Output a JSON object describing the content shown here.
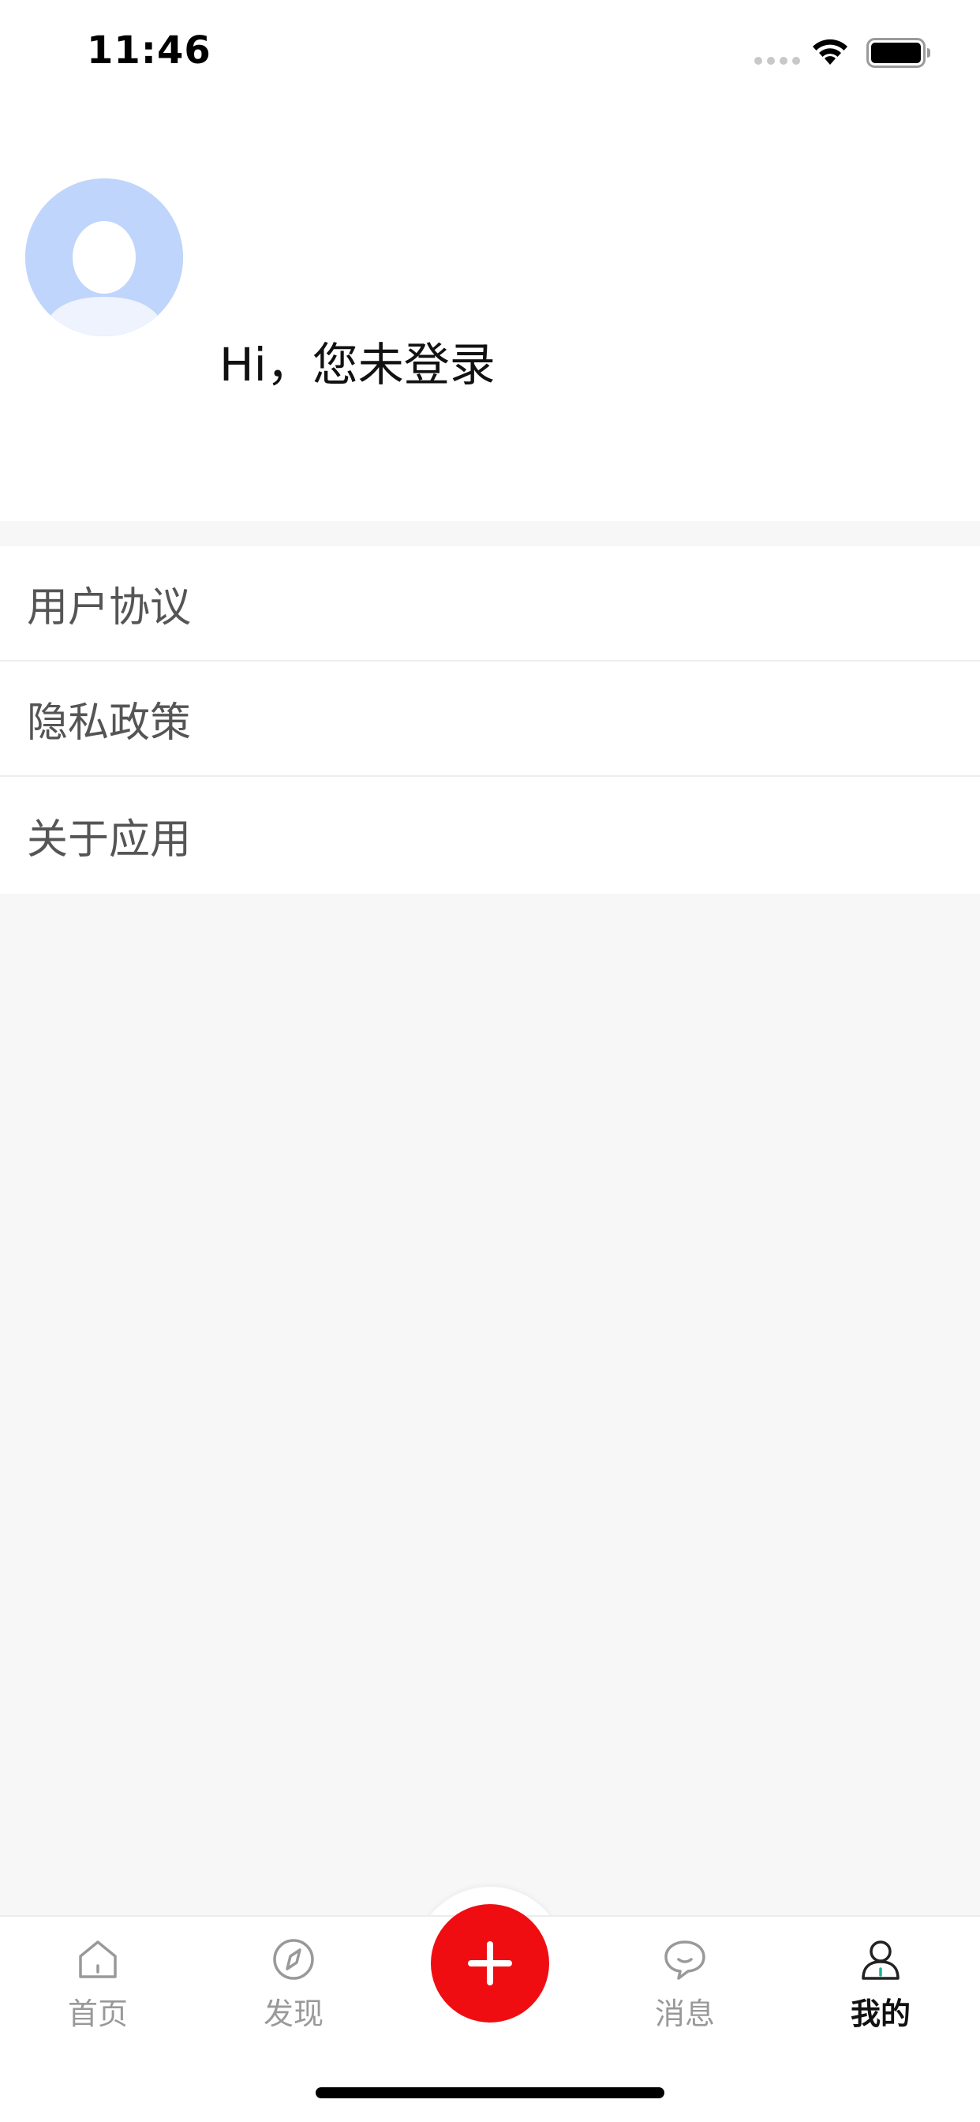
{
  "status_bar": {
    "time": "11:46"
  },
  "profile": {
    "greeting": "Hi，您未登录"
  },
  "menu": {
    "items": [
      {
        "label": "用户协议"
      },
      {
        "label": "隐私政策"
      },
      {
        "label": "关于应用"
      }
    ]
  },
  "tab_bar": {
    "tabs": [
      {
        "label": "首页",
        "icon": "home-icon"
      },
      {
        "label": "发现",
        "icon": "compass-icon"
      },
      {
        "label": "消息",
        "icon": "chat-bubble-icon"
      },
      {
        "label": "我的",
        "icon": "user-icon",
        "active": true
      }
    ],
    "add_icon": "plus-icon"
  },
  "colors": {
    "accent": "#f00d12",
    "avatar_bg": "#bfd5fb",
    "active_indicator": "#1ab394"
  }
}
